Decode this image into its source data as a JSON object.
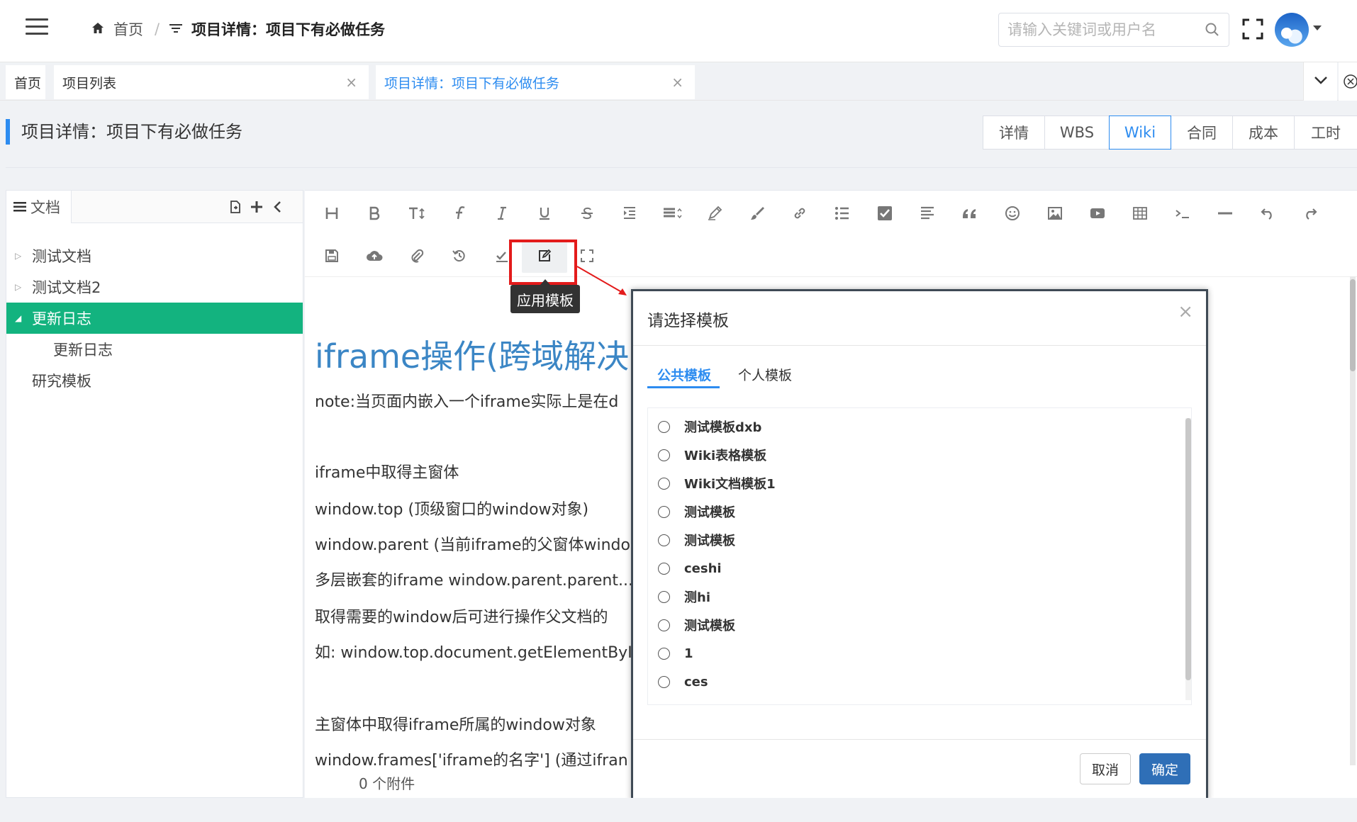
{
  "header": {
    "breadcrumb_home": "首页",
    "breadcrumb_sep": "/",
    "breadcrumb_current": "项目详情：项目下有必做任务",
    "search_placeholder": "请输入关键词或用户名"
  },
  "tabs": [
    {
      "label": "首页"
    },
    {
      "label": "项目列表",
      "close": "×"
    },
    {
      "label": "项目详情：项目下有必做任务",
      "close": "×"
    }
  ],
  "page": {
    "title": "项目详情：项目下有必做任务",
    "buttons": [
      "详情",
      "WBS",
      "Wiki",
      "合同",
      "成本",
      "工时"
    ],
    "active_button": "Wiki"
  },
  "left_panel": {
    "tab_label": "文档",
    "tree": [
      {
        "label": "测试文档",
        "arrow": "▷"
      },
      {
        "label": "测试文档2",
        "arrow": "▷"
      },
      {
        "label": "更新日志",
        "arrow": "◢"
      },
      {
        "label": "更新日志",
        "arrow": ""
      },
      {
        "label": "研究模板",
        "arrow": ""
      }
    ]
  },
  "editor": {
    "tooltip": "应用模板",
    "heading": "iframe操作(跨域解决",
    "paragraphs": [
      "note:当页面内嵌入一个iframe实际上是在d",
      "iframe中取得主窗体",
      "window.top (顶级窗口的window对象)",
      "window.parent (当前iframe的父窗体windo",
      "多层嵌套的iframe window.parent.parent...",
      "取得需要的window后可进行操作父文档的",
      "如: window.top.document.getElementById",
      "主窗体中取得iframe所属的window对象",
      "window.frames['iframe的名字']    (通过ifran"
    ],
    "attachments": "0 个附件"
  },
  "modal": {
    "title": "请选择模板",
    "close": "×",
    "tabs": [
      "公共模板",
      "个人模板"
    ],
    "templates": [
      "测试模板dxb",
      "Wiki表格模板",
      "Wiki文档模板1",
      "测试模板",
      "测试模板",
      "ceshi",
      "测hi",
      "测试模板",
      "1",
      "ces"
    ],
    "cancel": "取消",
    "ok": "确定"
  },
  "colors": {
    "accent": "#2d8cf0",
    "selected_tree": "#13b37f",
    "highlight_box": "#e31b1b",
    "ok_button": "#2f6fb7"
  }
}
